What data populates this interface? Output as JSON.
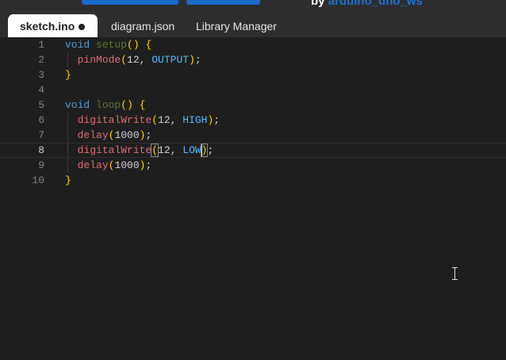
{
  "header": {
    "byline_prefix": "by",
    "byline_author": "arduino_uno_ws"
  },
  "tabs": [
    {
      "label": "sketch.ino",
      "active": true,
      "modified": true
    },
    {
      "label": "diagram.json",
      "active": false
    },
    {
      "label": "Library Manager",
      "active": false
    }
  ],
  "editor": {
    "current_line": 8,
    "lines": [
      {
        "n": "1",
        "tokens": [
          "void",
          " ",
          "setup",
          "()",
          " ",
          "{"
        ]
      },
      {
        "n": "2",
        "tokens": [
          "  ",
          "pinMode",
          "(",
          "12",
          ", ",
          "OUTPUT",
          ")",
          ";"
        ]
      },
      {
        "n": "3",
        "tokens": [
          "}"
        ]
      },
      {
        "n": "4",
        "tokens": []
      },
      {
        "n": "5",
        "tokens": [
          "void",
          " ",
          "loop",
          "()",
          " ",
          "{"
        ]
      },
      {
        "n": "6",
        "tokens": [
          "  ",
          "digitalWrite",
          "(",
          "12",
          ", ",
          "HIGH",
          ")",
          ";"
        ]
      },
      {
        "n": "7",
        "tokens": [
          "  ",
          "delay",
          "(",
          "1000",
          ")",
          ";"
        ]
      },
      {
        "n": "8",
        "tokens": [
          "  ",
          "digitalWrite",
          "(",
          "12",
          ", ",
          "LOW",
          ")",
          ";"
        ]
      },
      {
        "n": "9",
        "tokens": [
          "  ",
          "delay",
          "(",
          "1000",
          ")",
          ";"
        ]
      },
      {
        "n": "10",
        "tokens": [
          "}"
        ]
      }
    ]
  },
  "colors": {
    "keyword": "#569cd6",
    "function": "#e06c75",
    "paren": "#ffd700",
    "constant": "#4fc1ff",
    "accent": "#1b6ac9"
  },
  "icons": {
    "tab_dropdown": "chevron-down-icon",
    "modified_dot": "unsaved-dot-icon",
    "cursor": "text-cursor-icon"
  }
}
